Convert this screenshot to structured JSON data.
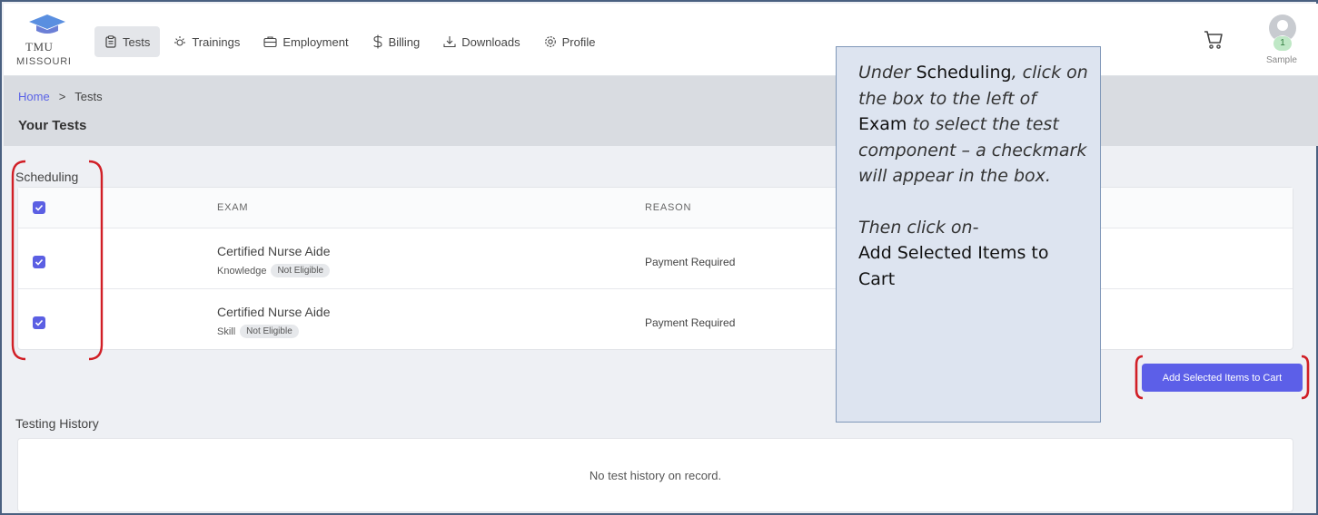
{
  "app": {
    "logo_line1": "TMU",
    "logo_line2": "MISSOURI"
  },
  "nav": {
    "items": [
      {
        "label": "Tests",
        "icon": "clipboard-icon",
        "active": true
      },
      {
        "label": "Trainings",
        "icon": "sun-icon"
      },
      {
        "label": "Employment",
        "icon": "briefcase-icon"
      },
      {
        "label": "Billing",
        "icon": "dollar-icon"
      },
      {
        "label": "Downloads",
        "icon": "download-icon"
      },
      {
        "label": "Profile",
        "icon": "gear-icon"
      }
    ]
  },
  "user": {
    "name": "Sample",
    "cart_count": "1"
  },
  "breadcrumb": {
    "home": "Home",
    "separator": ">",
    "current": "Tests"
  },
  "page": {
    "title": "Your Tests"
  },
  "scheduling": {
    "label": "Scheduling",
    "columns": {
      "exam": "EXAM",
      "reason": "REASON"
    },
    "rows": [
      {
        "exam": "Certified Nurse Aide",
        "type": "Knowledge",
        "status": "Not Eligible",
        "reason": "Payment Required",
        "checked": true
      },
      {
        "exam": "Certified Nurse Aide",
        "type": "Skill",
        "status": "Not Eligible",
        "reason": "Payment Required",
        "checked": true
      }
    ],
    "add_button": "Add Selected Items to Cart"
  },
  "history": {
    "label": "Testing History",
    "empty": "No test history on record."
  },
  "callout": {
    "p1": "Under",
    "k1": "Scheduling",
    "p2": ", click on the box to the left of",
    "k2": "Exam",
    "p3": "to select the test component – a checkmark will appear in the box.",
    "p4": "Then click on-",
    "k3": "Add Selected Items to Cart"
  },
  "colors": {
    "accent": "#5b5fe3",
    "annotation": "#d11f26",
    "callout_bg": "#dde4f0"
  }
}
